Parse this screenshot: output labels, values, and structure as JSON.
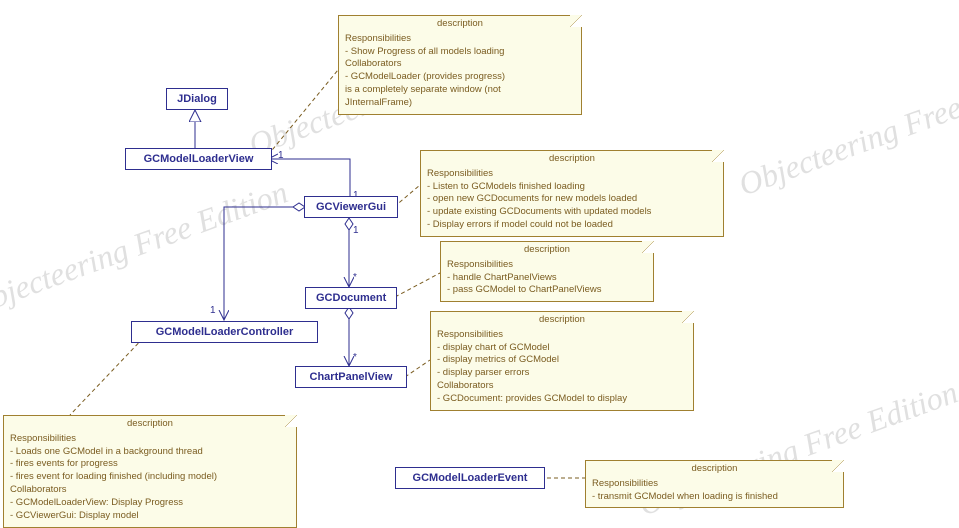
{
  "watermarks": {
    "w1": "Objecteering Free Edition",
    "w2": "Objecteering Free Edition",
    "w3": "Objecteering Free Edition",
    "w4": "Objecteering Free Edition"
  },
  "classes": {
    "jdialog": "JDialog",
    "gcmodelloaderview": "GCModelLoaderView",
    "gcviewergui": "GCViewerGui",
    "gcdocument": "GCDocument",
    "chartpanelview": "ChartPanelView",
    "gcmodelloadercontroller": "GCModelLoaderController",
    "gcmodelloaderevent": "GCModelLoaderEvent"
  },
  "notes": {
    "n1": {
      "title": "description",
      "lines": [
        "Responsibilities",
        "- Show Progress of all models loading",
        "Collaborators",
        "- GCModelLoader (provides progress)",
        "",
        "is a completely separate window (not",
        "JInternalFrame)"
      ]
    },
    "n2": {
      "title": "description",
      "lines": [
        "Responsibilities",
        "- Listen to GCModels finished loading",
        "- open new GCDocuments for new models loaded",
        "- update existing GCDocuments with updated models",
        "- Display errors if model could not be loaded"
      ]
    },
    "n3": {
      "title": "description",
      "lines": [
        "Responsibilities",
        "- handle ChartPanelViews",
        "- pass GCModel to ChartPanelViews"
      ]
    },
    "n4": {
      "title": "description",
      "lines": [
        "Responsibilities",
        "- display chart of GCModel",
        "- display metrics of GCModel",
        "- display parser errors",
        "Collaborators",
        "- GCDocument: provides GCModel to display"
      ]
    },
    "n5": {
      "title": "description",
      "lines": [
        "Responsibilities",
        "- Loads one GCModel in a background thread",
        "- fires events for progress",
        "- fires event for loading finished (including model)",
        "Collaborators",
        "- GCModelLoaderView: Display Progress",
        "- GCViewerGui: Display model"
      ]
    },
    "n6": {
      "title": "description",
      "lines": [
        "Responsibilities",
        "- transmit GCModel when loading is finished"
      ]
    }
  },
  "multiplicities": {
    "m1": "1",
    "m2": "1",
    "m3": "1",
    "m4": "1",
    "m5": "*",
    "m6": "*"
  }
}
